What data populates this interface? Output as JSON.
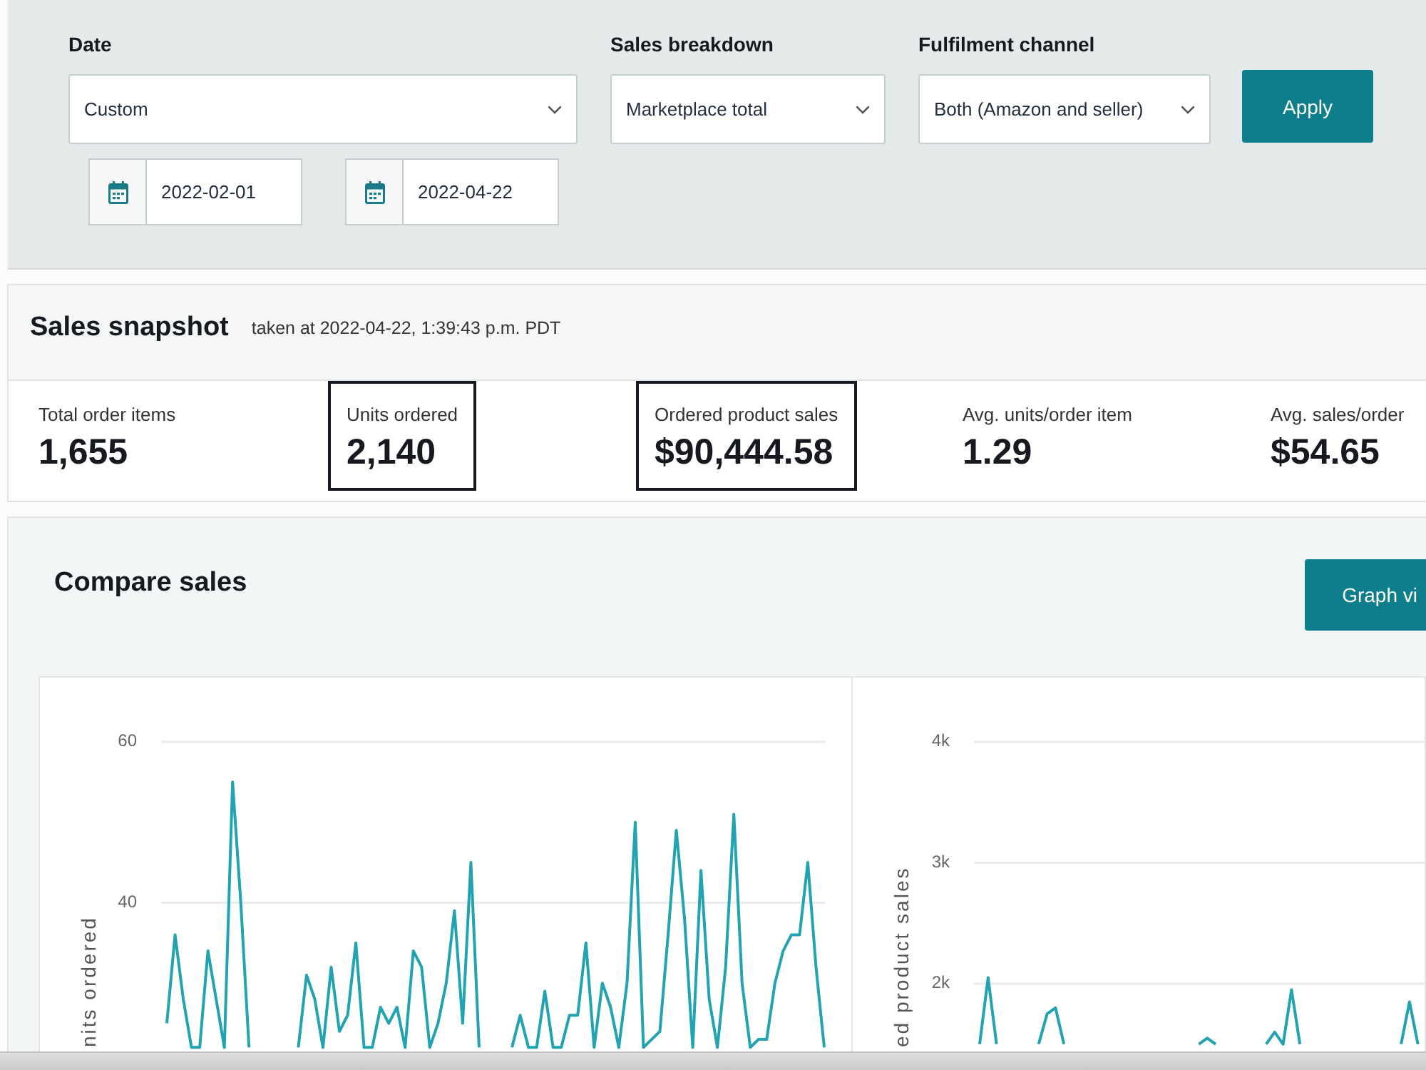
{
  "filters": {
    "date": {
      "label": "Date",
      "value": "Custom",
      "start_date": "2022-02-01",
      "end_date": "2022-04-22"
    },
    "sales_breakdown": {
      "label": "Sales breakdown",
      "value": "Marketplace total"
    },
    "fulfilment_channel": {
      "label": "Fulfilment channel",
      "value": "Both (Amazon and seller)"
    },
    "apply_button": "Apply"
  },
  "snapshot": {
    "title": "Sales snapshot",
    "taken_at": "taken at 2022-04-22, 1:39:43 p.m. PDT",
    "metrics": [
      {
        "label": "Total order items",
        "value": "1,655",
        "selected": false
      },
      {
        "label": "Units ordered",
        "value": "2,140",
        "selected": true
      },
      {
        "label": "Ordered product sales",
        "value": "$90,444.58",
        "selected": true
      },
      {
        "label": "Avg. units/order item",
        "value": "1.29",
        "selected": false
      },
      {
        "label": "Avg. sales/order",
        "value": "$54.65",
        "selected": false
      }
    ]
  },
  "compare": {
    "title": "Compare sales",
    "view_button": "Graph vi",
    "charts": [
      {
        "chart_data": {
          "type": "line",
          "ylabel": "nits ordered",
          "ylim": [
            21.5,
            60
          ],
          "yticks": [
            40,
            60
          ],
          "values": [
            25,
            36,
            28,
            22,
            22,
            34,
            28,
            22,
            55,
            40,
            22,
            null,
            null,
            null,
            null,
            null,
            22,
            31,
            28,
            22,
            32,
            24,
            26,
            35,
            22,
            22,
            27,
            25,
            27,
            22,
            34,
            32,
            22,
            25,
            30,
            39,
            25,
            45,
            22,
            null,
            null,
            null,
            22,
            26,
            22,
            22,
            29,
            22,
            22,
            26,
            26,
            35,
            22,
            30,
            27,
            22,
            30,
            50,
            22,
            23,
            24,
            36,
            49,
            38,
            22,
            44,
            28,
            22,
            32,
            51,
            30,
            22,
            23,
            23,
            30,
            34,
            36,
            36,
            45,
            32,
            22
          ]
        }
      },
      {
        "chart_data": {
          "type": "line",
          "ylabel": "ed product sales",
          "ylim": [
            1440,
            4000
          ],
          "yticks": [
            {
              "value": 2000,
              "label": "2k"
            },
            {
              "value": 3000,
              "label": "3k"
            },
            {
              "value": 4000,
              "label": "4k"
            }
          ],
          "values": [
            1500,
            2050,
            1500,
            null,
            null,
            null,
            null,
            1500,
            1750,
            1800,
            1500,
            null,
            null,
            null,
            null,
            null,
            null,
            null,
            null,
            null,
            null,
            null,
            null,
            null,
            null,
            null,
            1500,
            1550,
            1500,
            null,
            null,
            null,
            null,
            null,
            1500,
            1600,
            1500,
            1950,
            1500,
            null,
            null,
            null,
            null,
            null,
            null,
            null,
            null,
            null,
            null,
            null,
            1500,
            1850,
            1500,
            null,
            null,
            null,
            null,
            null,
            null,
            null,
            null,
            null,
            null,
            null,
            null,
            null,
            null,
            null,
            null,
            null,
            null,
            null,
            null,
            null,
            null,
            null,
            null,
            null,
            null
          ]
        }
      }
    ]
  }
}
